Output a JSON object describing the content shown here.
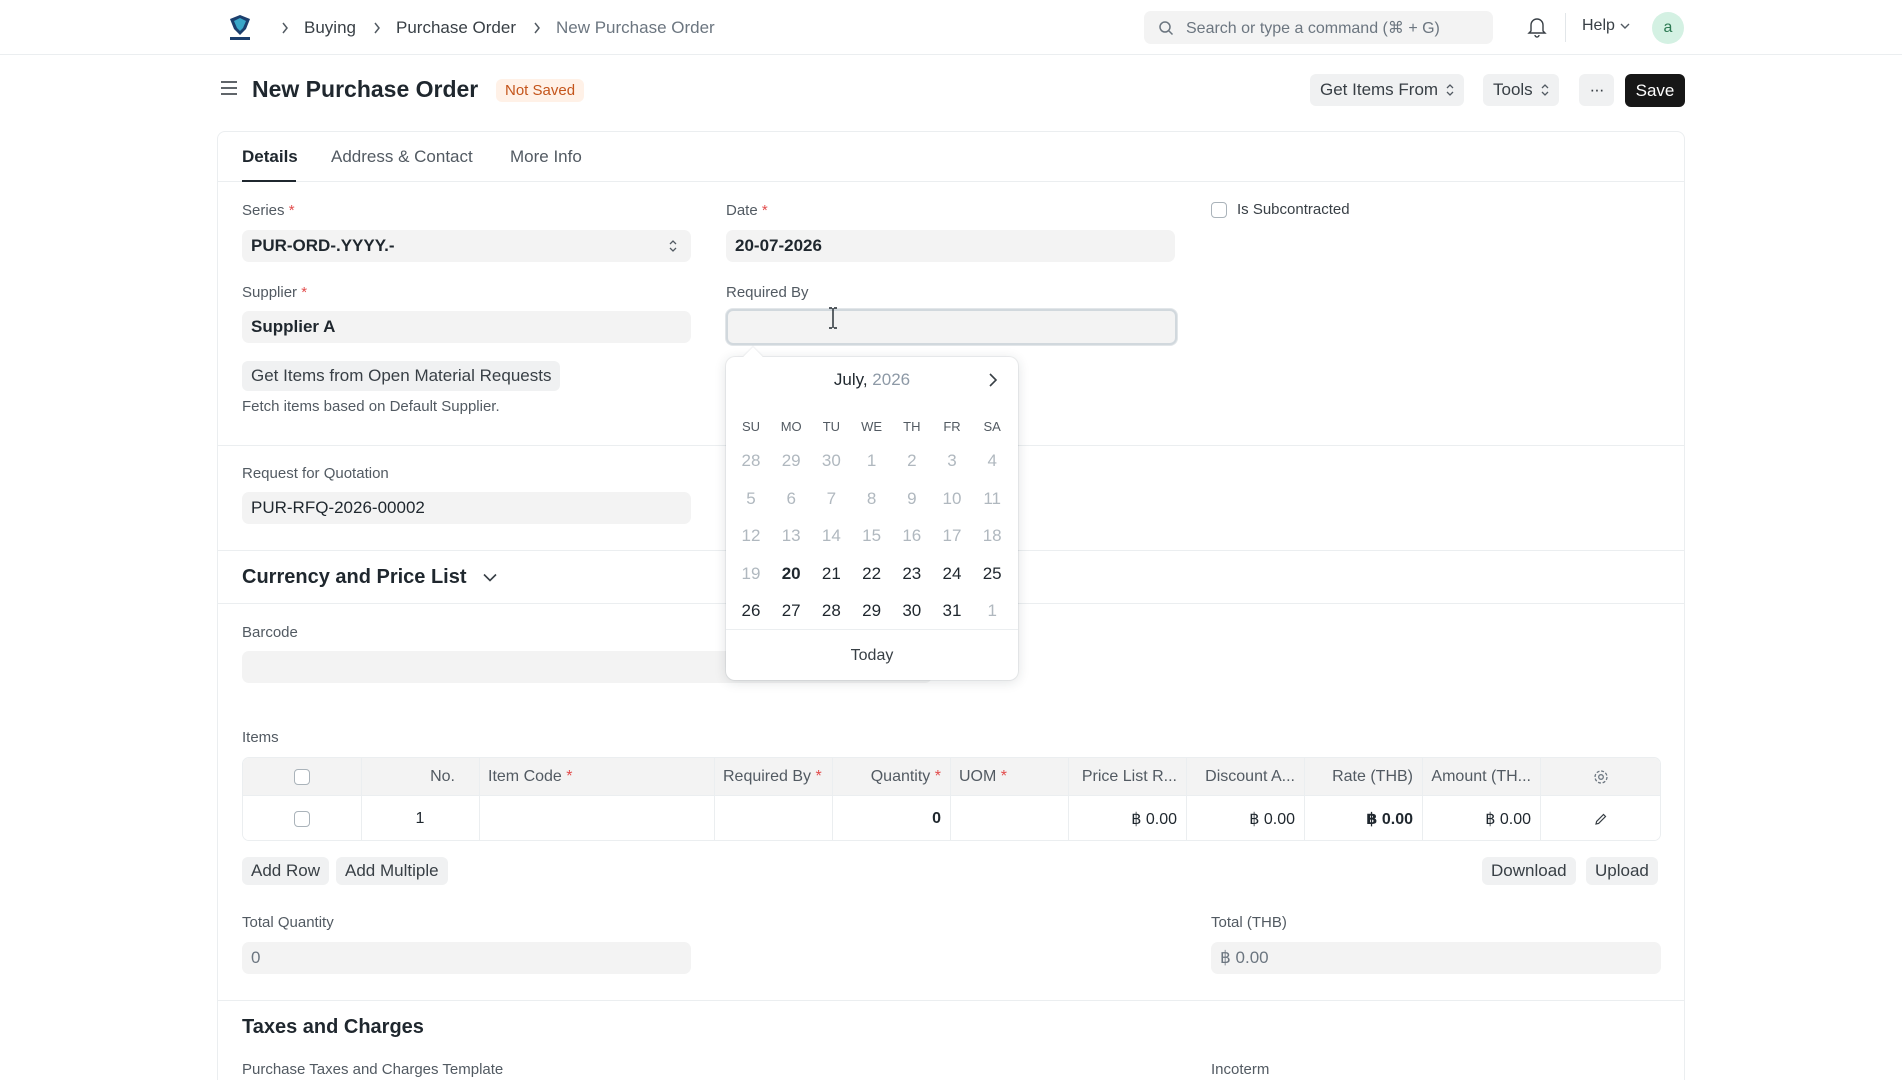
{
  "navbar": {
    "breadcrumbs": [
      "Buying",
      "Purchase Order",
      "New Purchase Order"
    ],
    "search_placeholder": "Search or type a command (⌘ + G)",
    "help_label": "Help",
    "avatar_initial": "a"
  },
  "page": {
    "title": "New Purchase Order",
    "status_badge": "Not Saved",
    "actions": {
      "get_items_from": "Get Items From",
      "tools": "Tools",
      "more": "···",
      "save": "Save"
    }
  },
  "tabs": [
    "Details",
    "Address & Contact",
    "More Info"
  ],
  "form": {
    "series": {
      "label": "Series",
      "value": "PUR-ORD-.YYYY.-"
    },
    "date": {
      "label": "Date",
      "value": "20-07-2026"
    },
    "is_subcontracted": {
      "label": "Is Subcontracted",
      "checked": false
    },
    "supplier": {
      "label": "Supplier",
      "value": "Supplier A"
    },
    "required_by": {
      "label": "Required By",
      "value": ""
    },
    "get_items_button": "Get Items from Open Material Requests",
    "get_items_help": "Fetch items based on Default Supplier.",
    "rfq": {
      "label": "Request for Quotation",
      "value": "PUR-RFQ-2026-00002"
    },
    "currency_section": "Currency and Price List",
    "barcode": {
      "label": "Barcode",
      "value": ""
    },
    "items_label": "Items",
    "total_quantity": {
      "label": "Total Quantity",
      "value": "0"
    },
    "total_thb": {
      "label": "Total (THB)",
      "value": "฿ 0.00"
    },
    "taxes_section": "Taxes and Charges",
    "taxes_template_label": "Purchase Taxes and Charges Template",
    "incoterm_label": "Incoterm"
  },
  "items_table": {
    "columns": [
      "No.",
      "Item Code",
      "Required By",
      "Quantity",
      "UOM",
      "Price List R...",
      "Discount A...",
      "Rate (THB)",
      "Amount (TH..."
    ],
    "required_columns": [
      "Item Code",
      "Required By",
      "Quantity",
      "UOM"
    ],
    "rows": [
      {
        "no": "1",
        "item_code": "",
        "required_by": "",
        "quantity": "0",
        "uom": "",
        "price_list_rate": "฿ 0.00",
        "discount_amount": "฿ 0.00",
        "rate": "฿ 0.00",
        "amount": "฿ 0.00"
      }
    ],
    "buttons": {
      "add_row": "Add Row",
      "add_multiple": "Add Multiple",
      "download": "Download",
      "upload": "Upload"
    }
  },
  "datepicker": {
    "month": "July,",
    "year": "2026",
    "day_names": [
      "SU",
      "MO",
      "TU",
      "WE",
      "TH",
      "FR",
      "SA"
    ],
    "weeks": [
      [
        "28",
        "29",
        "30",
        "1",
        "2",
        "3",
        "4"
      ],
      [
        "5",
        "6",
        "7",
        "8",
        "9",
        "10",
        "11"
      ],
      [
        "12",
        "13",
        "14",
        "15",
        "16",
        "17",
        "18"
      ],
      [
        "19",
        "20",
        "21",
        "22",
        "23",
        "24",
        "25"
      ],
      [
        "26",
        "27",
        "28",
        "29",
        "30",
        "31",
        "1"
      ]
    ],
    "today_button": "Today"
  },
  "colors": {
    "primary_button": "#171717",
    "badge_bg": "#fff1e7",
    "badge_text": "#c4551b",
    "field_bg": "#f3f3f3",
    "required_star": "#e24c4c"
  }
}
